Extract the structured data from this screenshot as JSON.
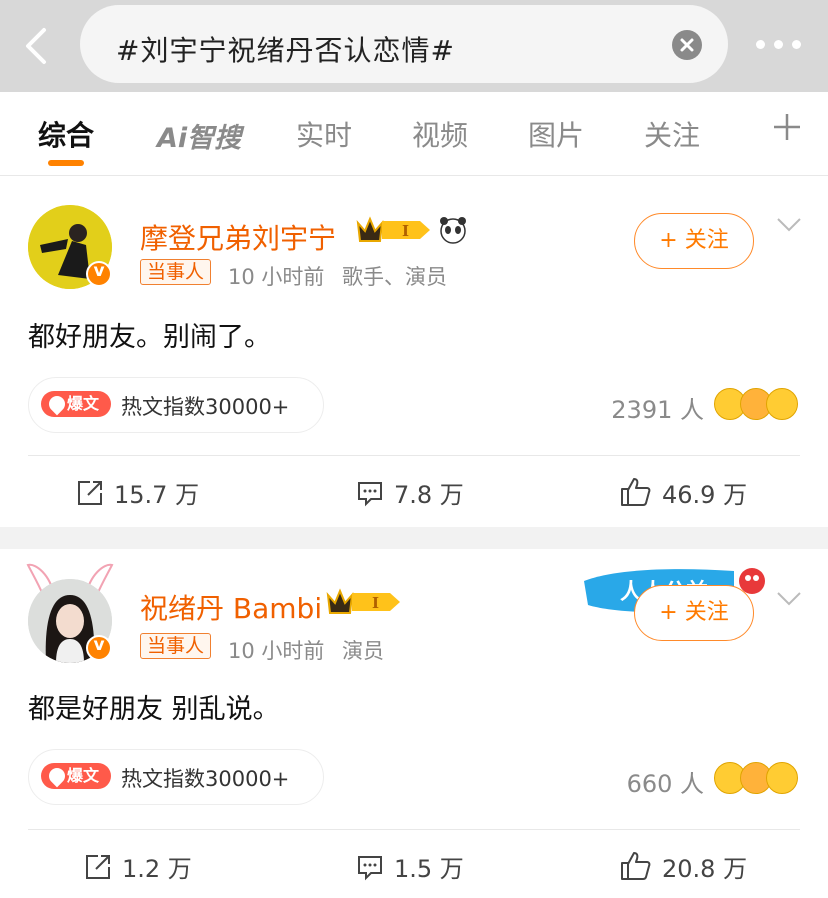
{
  "search": {
    "query": "#刘宇宁祝绪丹否认恋情#"
  },
  "tabs": [
    {
      "label": "综合"
    },
    {
      "label": "Ai智搜"
    },
    {
      "label": "实时"
    },
    {
      "label": "视频"
    },
    {
      "label": "图片"
    },
    {
      "label": "关注"
    }
  ],
  "colors": {
    "accent": "#ff8200",
    "name": "#f06000",
    "hot": "#ff5a4a"
  },
  "posts": [
    {
      "author": "摩登兄弟刘宇宁",
      "tag": "当事人",
      "time": "10 小时前",
      "role": "歌手、演员",
      "follow": "+ 关注",
      "text": "都好朋友。别闹了。",
      "hot_badge": "爆文",
      "hot_text": "热文指数30000+",
      "readers": "2391 人",
      "repost": "15.7 万",
      "comment": "7.8 万",
      "like": "46.9 万"
    },
    {
      "author": "祝绪丹 Bambi",
      "tag": "当事人",
      "time": "10 小时前",
      "role": "演员",
      "follow": "+ 关注",
      "campaign": "人人公益",
      "text": "都是好朋友 别乱说。",
      "hot_badge": "爆文",
      "hot_text": "热文指数30000+",
      "readers": "660 人",
      "repost": "1.2 万",
      "comment": "1.5 万",
      "like": "20.8 万"
    }
  ]
}
